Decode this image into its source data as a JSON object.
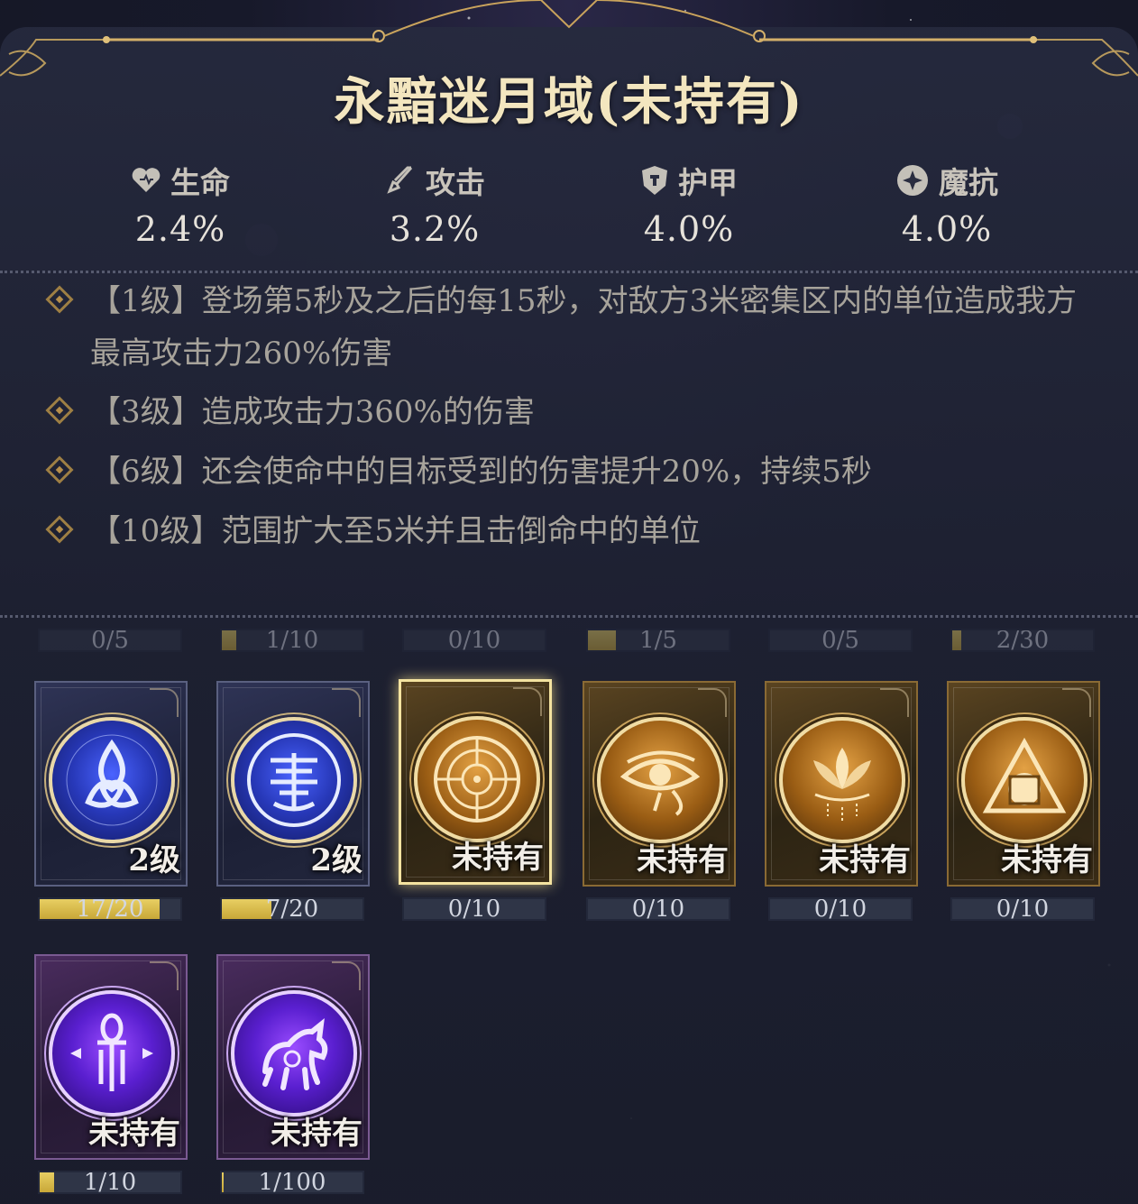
{
  "title": "永黯迷月域(未持有)",
  "stats": [
    {
      "label": "生命",
      "value": "2.4%",
      "icon": "heart-icon"
    },
    {
      "label": "攻击",
      "value": "3.2%",
      "icon": "sword-icon"
    },
    {
      "label": "护甲",
      "value": "4.0%",
      "icon": "shield-icon"
    },
    {
      "label": "魔抗",
      "value": "4.0%",
      "icon": "magic-resist-icon"
    }
  ],
  "effects": [
    {
      "text": "【1级】登场第5秒及之后的每15秒，对敌方3米密集区内的单位造成我方最高攻击力260%伤害"
    },
    {
      "text": "【3级】造成攻击力360%的伤害"
    },
    {
      "text": "【6级】还会使命中的目标受到的伤害提升20%，持续5秒"
    },
    {
      "text": "【10级】范围扩大至5米并且击倒命中的单位"
    }
  ],
  "top_progress": [
    {
      "text": "0/5",
      "fill": 0.0
    },
    {
      "text": "1/10",
      "fill": 0.1
    },
    {
      "text": "0/10",
      "fill": 0.0
    },
    {
      "text": "1/5",
      "fill": 0.2
    },
    {
      "text": "0/5",
      "fill": 0.0
    },
    {
      "text": "2/30",
      "fill": 0.067
    }
  ],
  "cards": [
    {
      "status": "2级",
      "progress": "17/20",
      "fill": 0.85,
      "theme": "blue",
      "icon": "triquetra-icon",
      "selected": false
    },
    {
      "status": "2级",
      "progress": "7/20",
      "fill": 0.35,
      "theme": "blue",
      "icon": "shou-symbol-icon",
      "selected": false
    },
    {
      "status": "未持有",
      "progress": "0/10",
      "fill": 0.0,
      "theme": "gold",
      "icon": "wheel-icon",
      "selected": true
    },
    {
      "status": "未持有",
      "progress": "0/10",
      "fill": 0.0,
      "theme": "gold",
      "icon": "eye-of-horus-icon",
      "selected": false
    },
    {
      "status": "未持有",
      "progress": "0/10",
      "fill": 0.0,
      "theme": "gold",
      "icon": "lotus-icon",
      "selected": false
    },
    {
      "status": "未持有",
      "progress": "0/10",
      "fill": 0.0,
      "theme": "gold",
      "icon": "triangle-circle-icon",
      "selected": false
    },
    {
      "status": "未持有",
      "progress": "1/10",
      "fill": 0.1,
      "theme": "purple",
      "icon": "ankh-icon",
      "selected": false
    },
    {
      "status": "未持有",
      "progress": "1/100",
      "fill": 0.01,
      "theme": "purple",
      "icon": "horse-icon",
      "selected": false
    }
  ],
  "colors": {
    "gold_accent": "#c9a35c",
    "title": "#f3e6bf",
    "fill": "#e2c552"
  }
}
